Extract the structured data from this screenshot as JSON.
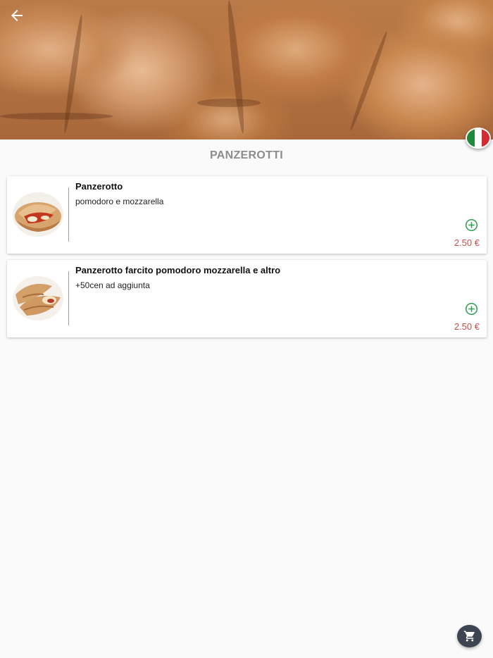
{
  "header": {
    "back_icon": "arrow-left-icon",
    "language_flag": "italy-flag-icon"
  },
  "section": {
    "title": "PANZEROTTI"
  },
  "products": [
    {
      "name": "Panzerotto",
      "description": "pomodoro e mozzarella",
      "price": "2.50 €",
      "add_icon": "plus-circle-icon"
    },
    {
      "name": "Panzerotto farcito pomodoro mozzarella e altro",
      "description": "+50cen ad aggiunta",
      "price": "2.50 €",
      "add_icon": "plus-circle-icon"
    }
  ],
  "cart": {
    "icon": "cart-icon"
  },
  "colors": {
    "price": "#c9504a",
    "add": "#2e9e4f",
    "cart_button": "#3d4452",
    "section_title": "#8c8c8c"
  }
}
